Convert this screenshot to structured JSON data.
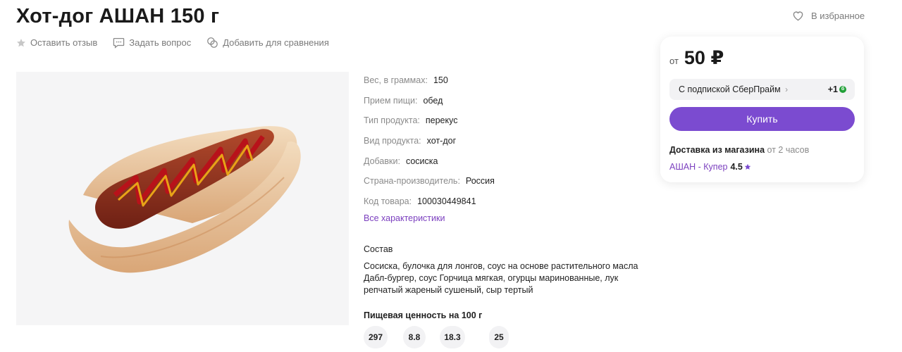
{
  "product": {
    "title": "Хот-дог АШАН 150 г"
  },
  "actions": {
    "review": "Оставить отзыв",
    "question": "Задать вопрос",
    "compare": "Добавить для сравнения"
  },
  "favorite": {
    "label": "В избранное"
  },
  "specs": [
    {
      "key": "Вес, в граммах:",
      "value": "150"
    },
    {
      "key": "Прием пищи:",
      "value": "обед"
    },
    {
      "key": "Тип продукта:",
      "value": "перекус"
    },
    {
      "key": "Вид продукта:",
      "value": "хот-дог"
    },
    {
      "key": "Добавки:",
      "value": "сосиска"
    },
    {
      "key": "Страна-производитель:",
      "value": "Россия"
    },
    {
      "key": "Код товара:",
      "value": "100030449841"
    }
  ],
  "all_specs_link": "Все характеристики",
  "composition": {
    "heading": "Состав",
    "text": "Сосиска, булочка для лонгов, соус на основе растительного масла Дабл-бургер, соус Горчица мягкая, огурцы маринованные, лук репчатый жареный сушеный, сыр тертый"
  },
  "nutrition": {
    "heading": "Пищевая ценность на 100 г",
    "values": [
      "297",
      "8.8",
      "18.3",
      "25"
    ]
  },
  "offer": {
    "price_prefix": "от",
    "price": "50 ₽",
    "subscription_label": "С подпиской СберПрайм",
    "subscription_bonus": "+1",
    "buy_label": "Купить",
    "delivery_label": "Доставка из магазина",
    "delivery_time": "от 2 часов",
    "shop_name": "АШАН - Купер",
    "shop_rating": "4.5"
  },
  "colors": {
    "accent": "#7b4bd0",
    "link": "#7b3fbf",
    "sber_green": "#21a038"
  }
}
